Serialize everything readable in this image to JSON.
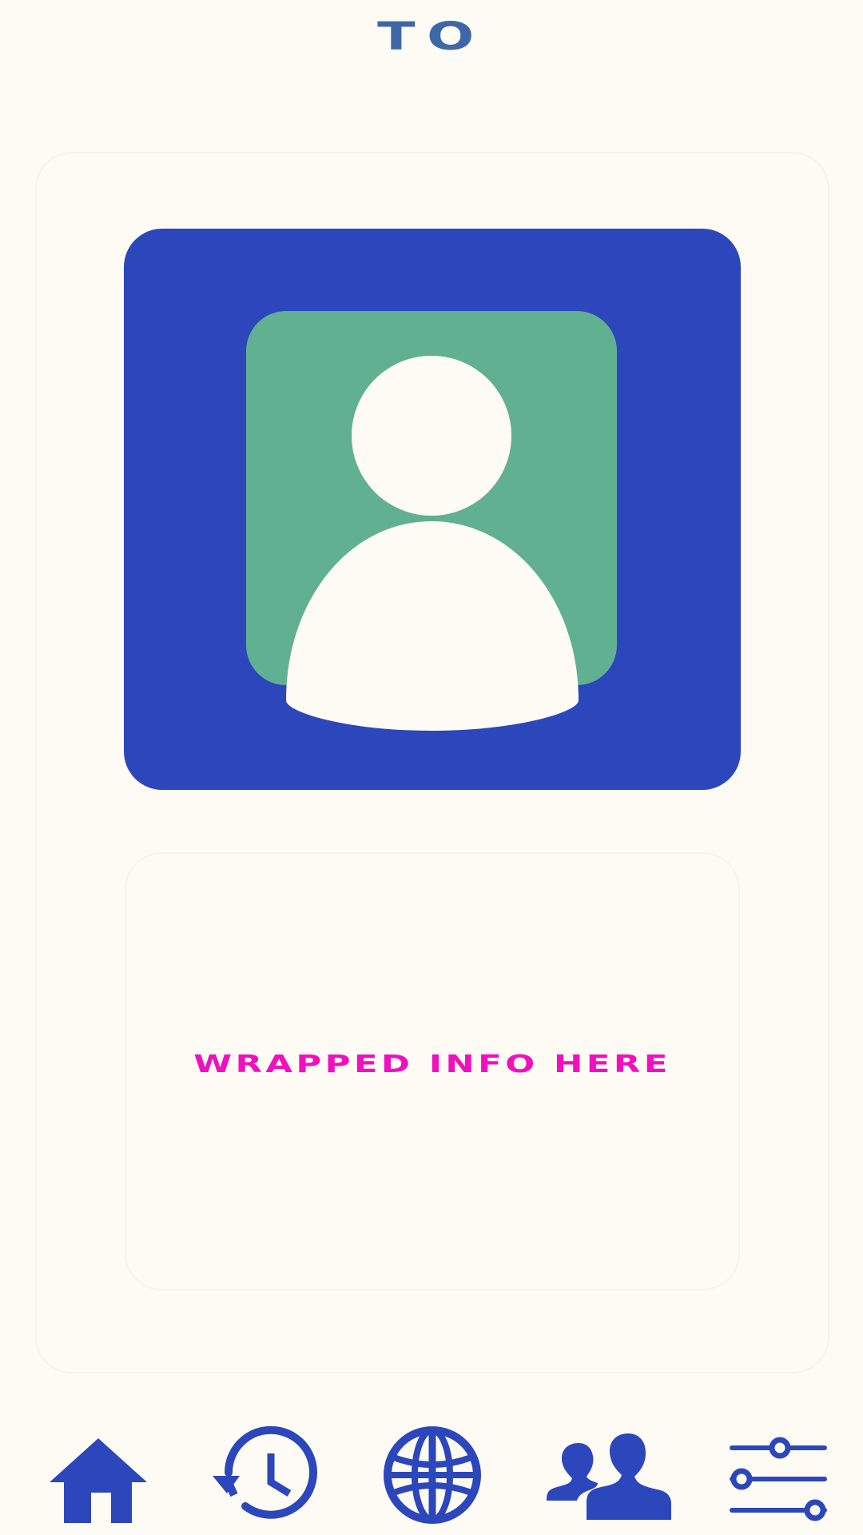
{
  "header": {
    "title": "TO"
  },
  "profile": {
    "avatar_icon": "user-silhouette-icon",
    "info_text": "WRAPPED INFO HERE"
  },
  "bottom_nav": {
    "items": [
      {
        "icon": "home-icon"
      },
      {
        "icon": "history-icon"
      },
      {
        "icon": "globe-icon"
      },
      {
        "icon": "contacts-icon"
      },
      {
        "icon": "sliders-icon"
      }
    ]
  },
  "colors": {
    "background": "#FEFBF4",
    "title": "#3E67A8",
    "frame": "#2C46BC",
    "avatar_bg": "#61B091",
    "avatar_figure": "#FEFBF4",
    "info_text": "#F00FC1",
    "nav_icon": "#2C46BC"
  }
}
